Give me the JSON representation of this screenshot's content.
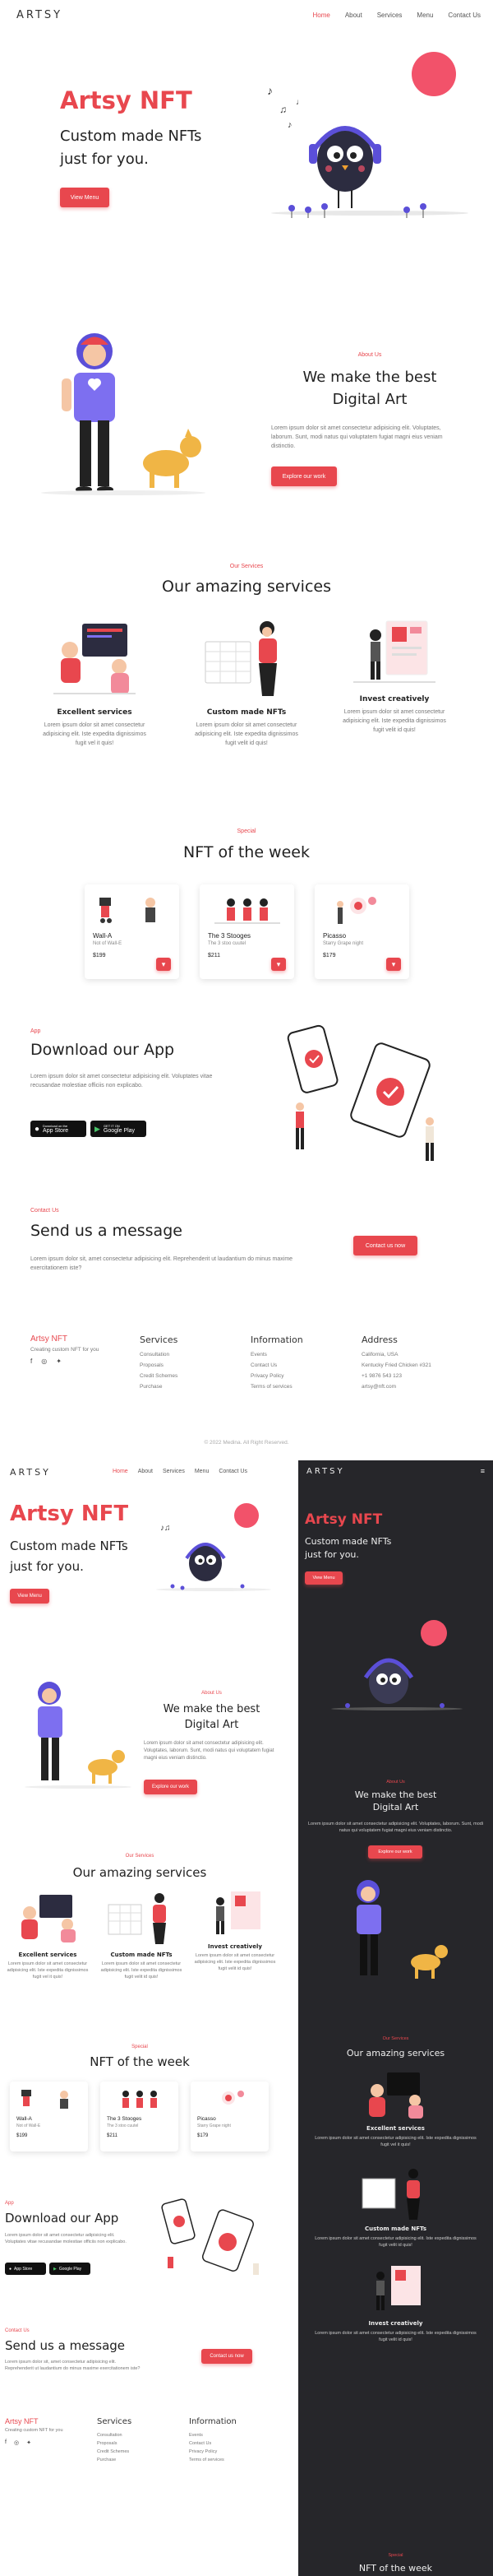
{
  "brand": "ARTSY",
  "nav": [
    "Home",
    "About",
    "Services",
    "Menu",
    "Contact Us"
  ],
  "hero": {
    "title": "Artsy NFT",
    "subtitle_l1": "Custom made NFTs",
    "subtitle_l2": "just for you.",
    "button": "View Menu"
  },
  "about": {
    "eyebrow": "About Us",
    "title_l1": "We make the best",
    "title_l2": "Digital Art",
    "body": "Lorem ipsum dolor sit amet consectetur adipisicing elit. Voluptates, laborum. Sunt, modi natus qui voluptatem fugiat magni eius veniam distinctio.",
    "button": "Explore our work"
  },
  "services": {
    "eyebrow": "Our Services",
    "title": "Our amazing services",
    "items": [
      {
        "title": "Excellent services",
        "body": "Lorem ipsum dolor sit amet consectetur adipisicing elit. Iste expedita dignissimos fugit vel it quis!"
      },
      {
        "title": "Custom made NFTs",
        "body": "Lorem ipsum dolor sit amet consectetur adipisicing elit. Iste expedita dignissimos fugit velit id quis!"
      },
      {
        "title": "Invest creatively",
        "body": "Lorem ipsum dolor sit amet consectetur adipisicing elit. Iste expedita dignissimos fugit velit id quis!"
      }
    ]
  },
  "special": {
    "eyebrow": "Special",
    "title": "NFT of the week",
    "items": [
      {
        "name": "Wall-A",
        "desc": "Not of Wall-E",
        "price": "$199"
      },
      {
        "name": "The 3 Stooges",
        "desc": "The 3 stoo cuutel",
        "price": "$211"
      },
      {
        "name": "Picasso",
        "desc": "Starry Grape night",
        "price": "$179"
      }
    ]
  },
  "app": {
    "eyebrow": "App",
    "title": "Download our App",
    "body": "Lorem ipsum dolor sit amet consectetur adipisicing elit. Voluptates vitae recusandae molestiae officiis non explicabo.",
    "appstore_small": "Download on the",
    "appstore": "App Store",
    "gplay_small": "GET IT ON",
    "gplay": "Google Play"
  },
  "contact": {
    "eyebrow": "Contact Us",
    "title": "Send us a message",
    "body": "Lorem ipsum dolor sit, amet consectetur adipisicing elit. Reprehenderit ut laudantium do minus maxime exercitationem iste?",
    "button": "Contact us now"
  },
  "footer": {
    "brand": "Artsy NFT",
    "tag": "Creating custom NFT for you",
    "services_h": "Services",
    "services": [
      "Consultation",
      "Proposals",
      "Credit Schemes",
      "Purchase"
    ],
    "info_h": "Information",
    "info": [
      "Events",
      "Contact Us",
      "Privacy Policy",
      "Terms of services"
    ],
    "addr_h": "Address",
    "addr": [
      "California, USA",
      "Kentucky Fried Chicken #321",
      "+1 9876 543 123",
      "artsy@nft.com"
    ],
    "copyright": "© 2022 Medina. All Right Reserved."
  },
  "colors": {
    "accent": "#e8474e",
    "dark_bg": "#26262a"
  }
}
